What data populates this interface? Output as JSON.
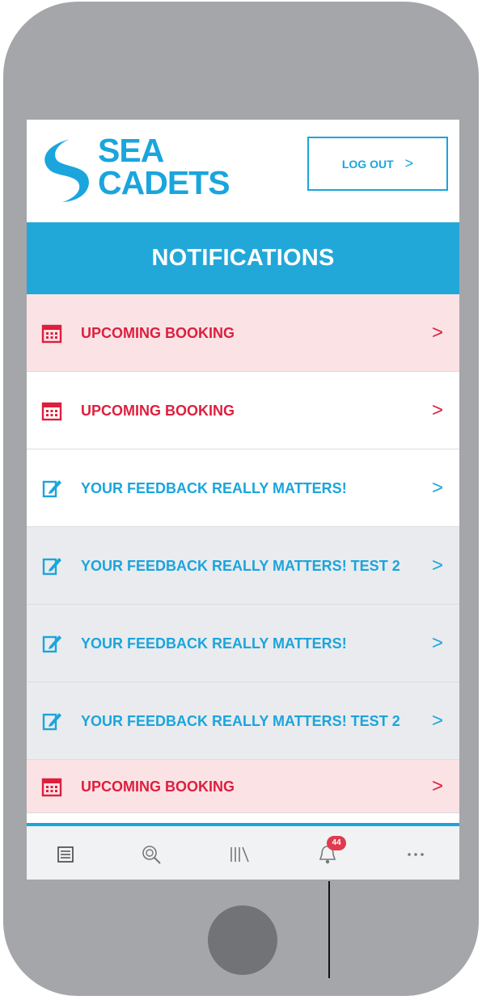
{
  "brand": {
    "line1": "SEA",
    "line2": "CADETS"
  },
  "header": {
    "logout_label": "LOG OUT",
    "title": "NOTIFICATIONS"
  },
  "notifications": [
    {
      "label": "UPCOMING BOOKING",
      "icon": "calendar-icon",
      "color": "#dd1f3e",
      "background": "#fbe3e5"
    },
    {
      "label": "UPCOMING BOOKING",
      "icon": "calendar-icon",
      "color": "#dd1f3e",
      "background": "#ffffff"
    },
    {
      "label": "YOUR FEEDBACK REALLY MATTERS!",
      "icon": "edit-icon",
      "color": "#1aa5dd",
      "background": "#ffffff"
    },
    {
      "label": "YOUR FEEDBACK REALLY MATTERS! TEST 2",
      "icon": "edit-icon",
      "color": "#1aa5dd",
      "background": "#eaebee"
    },
    {
      "label": "YOUR FEEDBACK REALLY MATTERS!",
      "icon": "edit-icon",
      "color": "#1aa5dd",
      "background": "#eaebee"
    },
    {
      "label": "YOUR FEEDBACK REALLY MATTERS! TEST 2",
      "icon": "edit-icon",
      "color": "#1aa5dd",
      "background": "#eaebee"
    },
    {
      "label": "UPCOMING BOOKING",
      "icon": "calendar-icon",
      "color": "#dd1f3e",
      "background": "#fbe3e5"
    }
  ],
  "tabs": [
    {
      "icon": "list-icon"
    },
    {
      "icon": "search-icon"
    },
    {
      "icon": "library-icon"
    },
    {
      "icon": "bell-icon",
      "badge": "44"
    },
    {
      "icon": "more-icon"
    }
  ],
  "colors": {
    "accent": "#1aa5dd",
    "alert": "#dd1f3e",
    "phone": "#a5a6a9"
  }
}
